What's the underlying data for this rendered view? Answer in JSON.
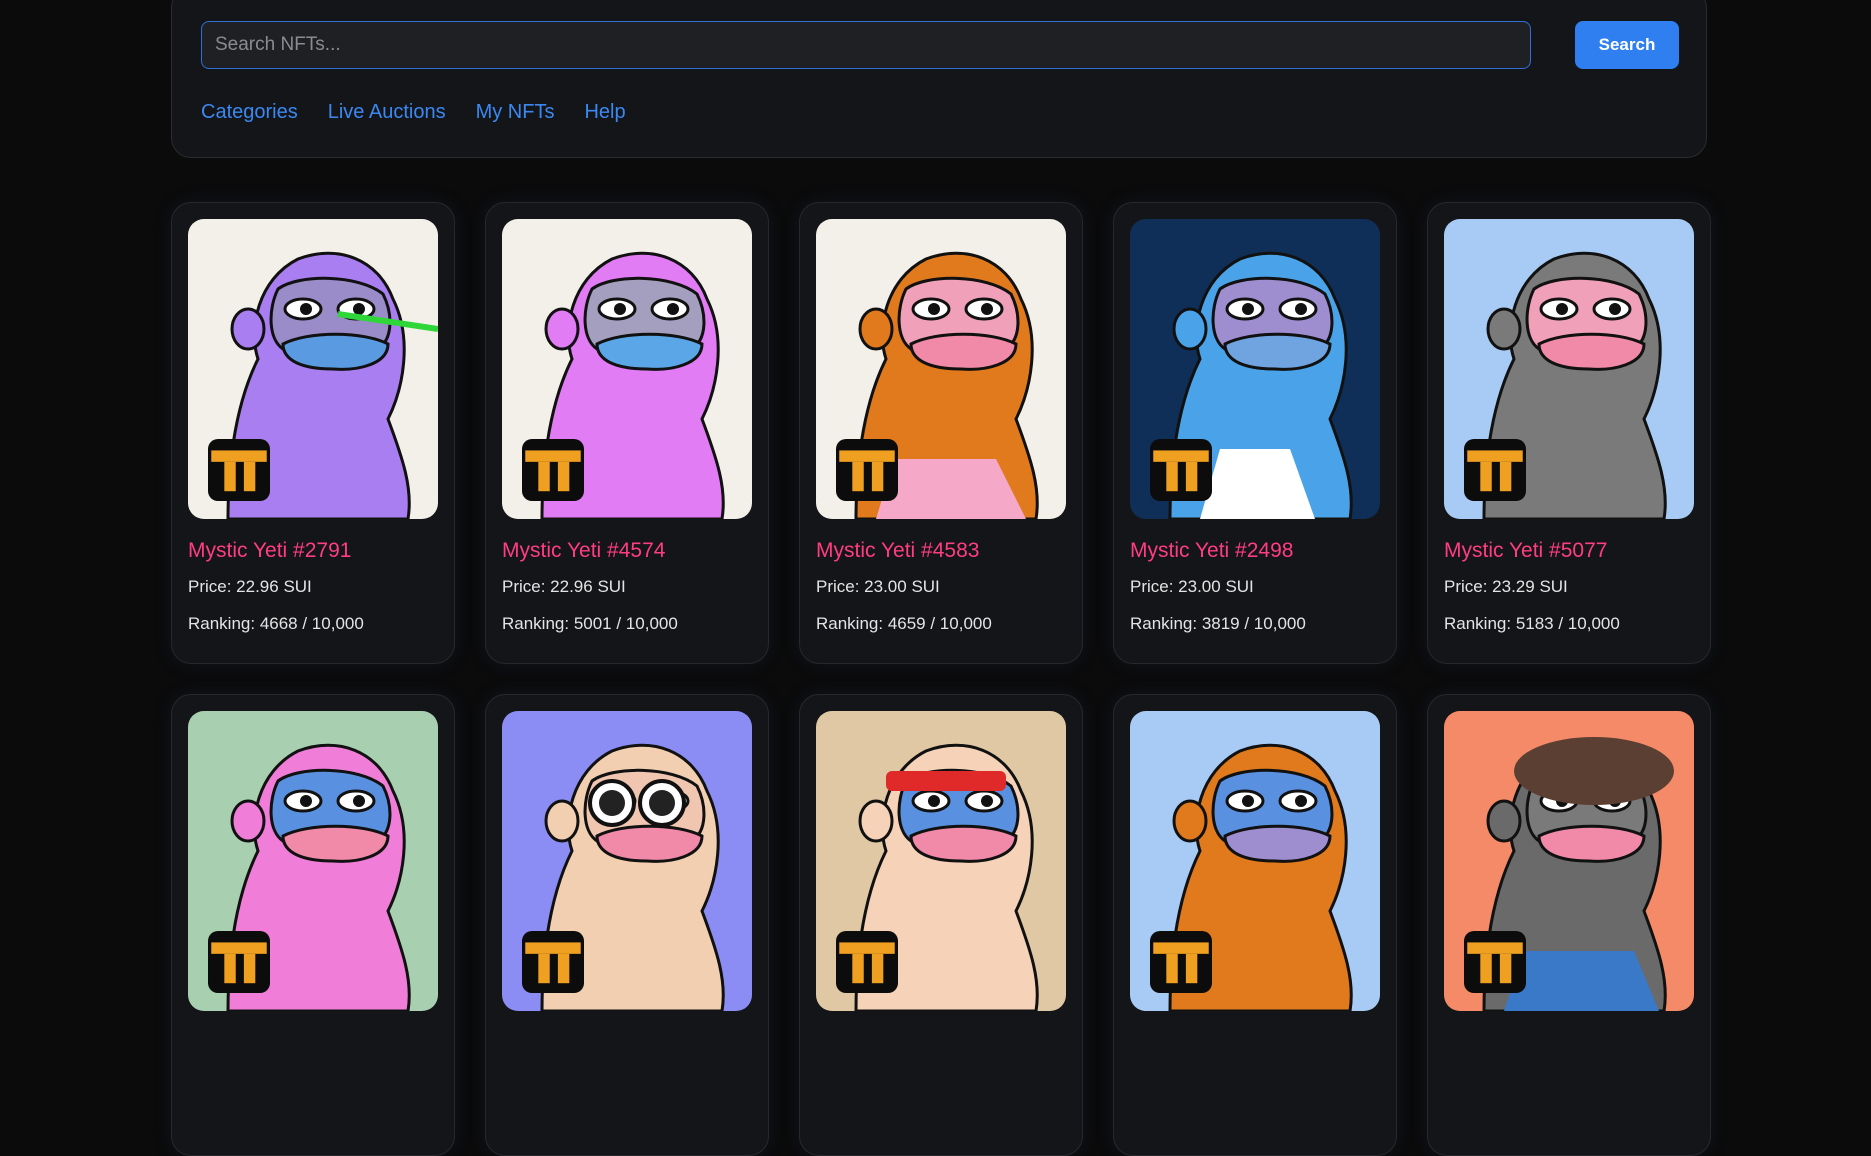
{
  "search": {
    "placeholder": "Search NFTs...",
    "value": "",
    "button_label": "Search"
  },
  "nav": [
    {
      "label": "Categories"
    },
    {
      "label": "Live Auctions"
    },
    {
      "label": "My NFTs"
    },
    {
      "label": "Help"
    }
  ],
  "badge_text": "T",
  "items": [
    {
      "title": "Mystic Yeti #2791",
      "price": "Price: 22.96 SUI",
      "ranking": "Ranking: 4668 / 10,000",
      "bg": "#f3efe9",
      "fur": "#a97ef0",
      "face": "#9a8cc8",
      "mouth": "#5a9ae0",
      "accent": "#2fd63a"
    },
    {
      "title": "Mystic Yeti #4574",
      "price": "Price: 22.96 SUI",
      "ranking": "Ranking: 5001 / 10,000",
      "bg": "#f3efe9",
      "fur": "#e17cf5",
      "face": "#a59fbf",
      "mouth": "#5aa6e6",
      "accent": ""
    },
    {
      "title": "Mystic Yeti #4583",
      "price": "Price: 23.00 SUI",
      "ranking": "Ranking: 4659 / 10,000",
      "bg": "#f3efe9",
      "fur": "#e07a1c",
      "face": "#f0a0b8",
      "mouth": "#f08aa8",
      "accent": "#f5a8c8"
    },
    {
      "title": "Mystic Yeti #2498",
      "price": "Price: 23.00 SUI",
      "ranking": "Ranking: 3819 / 10,000",
      "bg": "#0f2f58",
      "fur": "#4aa3e8",
      "face": "#9e8ed0",
      "mouth": "#6fa4e0",
      "accent": "#ffffff"
    },
    {
      "title": "Mystic Yeti #5077",
      "price": "Price: 23.29 SUI",
      "ranking": "Ranking: 5183 / 10,000",
      "bg": "#a8cbf5",
      "fur": "#7a7a7a",
      "face": "#f0a0b8",
      "mouth": "#f08aa8",
      "accent": ""
    },
    {
      "title": "",
      "price": "",
      "ranking": "",
      "bg": "#a8d0b0",
      "fur": "#f07ed8",
      "face": "#5a90e0",
      "mouth": "#f08aa8",
      "accent": ""
    },
    {
      "title": "",
      "price": "",
      "ranking": "",
      "bg": "#8c8cf5",
      "fur": "#f2cfb0",
      "face": "#f0c6b0",
      "mouth": "#f08aa8",
      "accent": "#ffffff"
    },
    {
      "title": "",
      "price": "",
      "ranking": "",
      "bg": "#e0c8a4",
      "fur": "#f5d2b8",
      "face": "#5a90e0",
      "mouth": "#f08aa8",
      "accent": "#e02a2a"
    },
    {
      "title": "",
      "price": "",
      "ranking": "",
      "bg": "#a8cbf5",
      "fur": "#e07a1c",
      "face": "#5a90e0",
      "mouth": "#9e8ed0",
      "accent": ""
    },
    {
      "title": "",
      "price": "",
      "ranking": "",
      "bg": "#f58a68",
      "fur": "#6a6a6a",
      "face": "#7a7a7a",
      "mouth": "#f08aa8",
      "accent": "#3a78c8"
    }
  ]
}
